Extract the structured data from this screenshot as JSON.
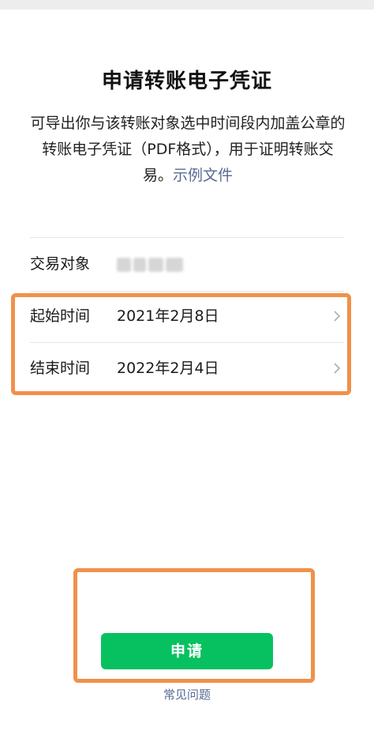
{
  "page": {
    "title": "申请转账电子凭证",
    "description_main": "可导出你与该转账对象选中时间段内加盖公章的转账电子凭证（PDF格式），用于证明转账交易。",
    "description_link": "示例文件"
  },
  "form": {
    "counterparty": {
      "label": "交易对象",
      "value_redacted": true
    },
    "start": {
      "label": "起始时间",
      "value": "2021年2月8日"
    },
    "end": {
      "label": "结束时间",
      "value": "2022年2月4日"
    }
  },
  "actions": {
    "apply_label": "申请",
    "faq_label": "常见问题"
  },
  "colors": {
    "primary_green": "#07c160",
    "link_blue": "#576b95",
    "highlight_orange": "#f0914a"
  },
  "icons": {
    "row_arrow": "chevron-right-icon"
  }
}
